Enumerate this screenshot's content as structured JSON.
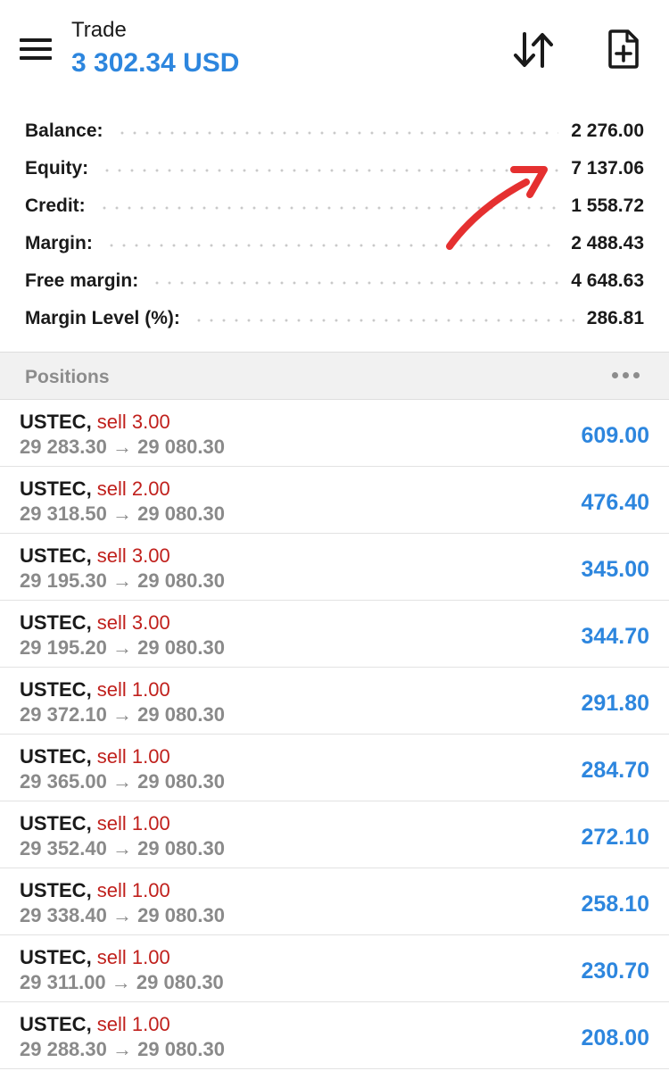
{
  "header": {
    "title": "Trade",
    "balance": "3 302.34 USD",
    "icons": [
      "menu-icon",
      "sort-arrows-icon",
      "new-order-icon"
    ]
  },
  "colors": {
    "accent": "#2d86de",
    "sell": "#c0201c",
    "muted": "#8a8a8a",
    "annotation": "#e53030"
  },
  "summary": [
    {
      "label": "Balance:",
      "value": "2 276.00"
    },
    {
      "label": "Equity:",
      "value": "7 137.06"
    },
    {
      "label": "Credit:",
      "value": "1 558.72"
    },
    {
      "label": "Margin:",
      "value": "2 488.43"
    },
    {
      "label": "Free margin:",
      "value": "4 648.63"
    },
    {
      "label": "Margin Level (%):",
      "value": "286.81"
    }
  ],
  "positions_header": {
    "title": "Positions"
  },
  "positions": [
    {
      "symbol": "USTEC",
      "side": "sell 3.00",
      "open": "29 283.30",
      "arrow": "→",
      "current": "29 080.30",
      "profit": "609.00"
    },
    {
      "symbol": "USTEC",
      "side": "sell 2.00",
      "open": "29 318.50",
      "arrow": "→",
      "current": "29 080.30",
      "profit": "476.40"
    },
    {
      "symbol": "USTEC",
      "side": "sell 3.00",
      "open": "29 195.30",
      "arrow": "→",
      "current": "29 080.30",
      "profit": "345.00"
    },
    {
      "symbol": "USTEC",
      "side": "sell 3.00",
      "open": "29 195.20",
      "arrow": "→",
      "current": "29 080.30",
      "profit": "344.70"
    },
    {
      "symbol": "USTEC",
      "side": "sell 1.00",
      "open": "29 372.10",
      "arrow": "→",
      "current": "29 080.30",
      "profit": "291.80"
    },
    {
      "symbol": "USTEC",
      "side": "sell 1.00",
      "open": "29 365.00",
      "arrow": "→",
      "current": "29 080.30",
      "profit": "284.70"
    },
    {
      "symbol": "USTEC",
      "side": "sell 1.00",
      "open": "29 352.40",
      "arrow": "→",
      "current": "29 080.30",
      "profit": "272.10"
    },
    {
      "symbol": "USTEC",
      "side": "sell 1.00",
      "open": "29 338.40",
      "arrow": "→",
      "current": "29 080.30",
      "profit": "258.10"
    },
    {
      "symbol": "USTEC",
      "side": "sell 1.00",
      "open": "29 311.00",
      "arrow": "→",
      "current": "29 080.30",
      "profit": "230.70"
    },
    {
      "symbol": "USTEC",
      "side": "sell 1.00",
      "open": "29 288.30",
      "arrow": "→",
      "current": "29 080.30",
      "profit": "208.00"
    }
  ]
}
